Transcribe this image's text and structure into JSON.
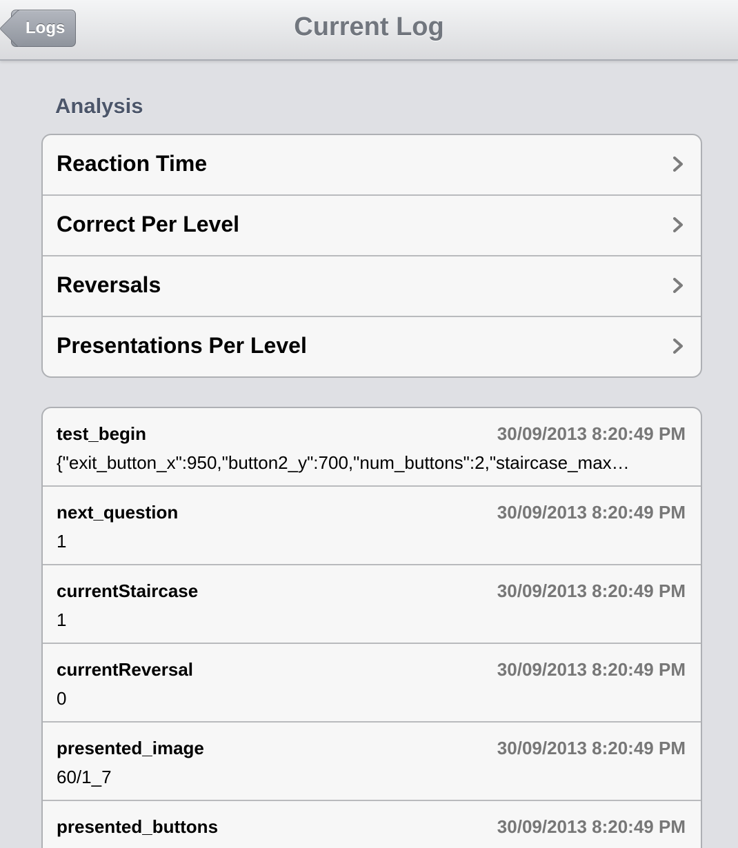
{
  "navbar": {
    "back_label": "Logs",
    "title": "Current Log"
  },
  "analysis": {
    "header": "Analysis",
    "items": [
      {
        "label": "Reaction Time"
      },
      {
        "label": "Correct Per Level"
      },
      {
        "label": "Reversals"
      },
      {
        "label": "Presentations Per Level"
      }
    ]
  },
  "log": {
    "entries": [
      {
        "name": "test_begin",
        "timestamp": "30/09/2013 8:20:49 PM",
        "value": "{\"exit_button_x\":950,\"button2_y\":700,\"num_buttons\":2,\"staircase_max…"
      },
      {
        "name": "next_question",
        "timestamp": "30/09/2013 8:20:49 PM",
        "value": "1"
      },
      {
        "name": "currentStaircase",
        "timestamp": "30/09/2013 8:20:49 PM",
        "value": "1"
      },
      {
        "name": "currentReversal",
        "timestamp": "30/09/2013 8:20:49 PM",
        "value": "0"
      },
      {
        "name": "presented_image",
        "timestamp": "30/09/2013 8:20:49 PM",
        "value": "60/1_7"
      },
      {
        "name": "presented_buttons",
        "timestamp": "30/09/2013 8:20:49 PM",
        "value": ""
      }
    ]
  }
}
